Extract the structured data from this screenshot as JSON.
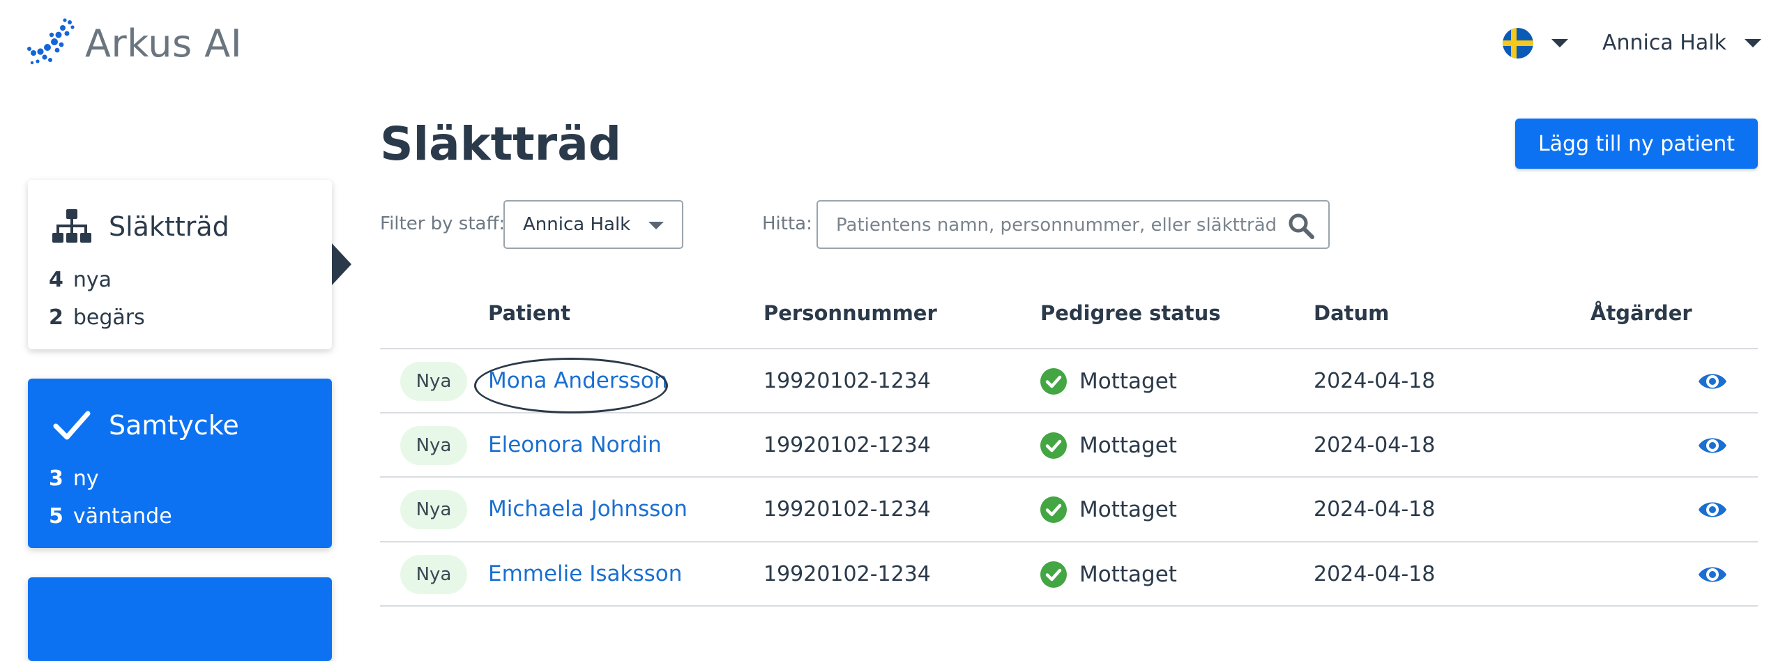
{
  "app": {
    "logo_text": "Arkus AI"
  },
  "header": {
    "language_icon": "sweden-flag-icon",
    "user_name": "Annica Halk"
  },
  "sidebar": {
    "cards": [
      {
        "title": "Släktträd",
        "icon": "family-tree-icon",
        "lines": [
          {
            "count": "4",
            "label": "nya"
          },
          {
            "count": "2",
            "label": "begärs"
          }
        ]
      },
      {
        "title": "Samtycke",
        "icon": "checkmark-icon",
        "lines": [
          {
            "count": "3",
            "label": "ny"
          },
          {
            "count": "5",
            "label": "väntande"
          }
        ]
      }
    ]
  },
  "page": {
    "title": "Släktträd",
    "add_button": "Lägg till ny patient"
  },
  "filter": {
    "label": "Filter by staff:",
    "selected": "Annica Halk"
  },
  "search": {
    "label": "Hitta:",
    "placeholder": "Patientens namn, personnummer, eller släktträd ID"
  },
  "table": {
    "columns": [
      "Patient",
      "Personnummer",
      "Pedigree status",
      "Datum",
      "Åtgärder"
    ],
    "rows": [
      {
        "badge": "Nya",
        "name": "Mona Andersson",
        "personnummer": "19920102-1234",
        "status": "Mottaget",
        "date": "2024-04-18"
      },
      {
        "badge": "Nya",
        "name": "Eleonora Nordin",
        "personnummer": "19920102-1234",
        "status": "Mottaget",
        "date": "2024-04-18"
      },
      {
        "badge": "Nya",
        "name": "Michaela Johnsson",
        "personnummer": "19920102-1234",
        "status": "Mottaget",
        "date": "2024-04-18"
      },
      {
        "badge": "Nya",
        "name": "Emmelie Isaksson",
        "personnummer": "19920102-1234",
        "status": "Mottaget",
        "date": "2024-04-18"
      }
    ]
  },
  "colors": {
    "primary": "#0d72f2",
    "text": "#2b3a4a",
    "link": "#1a6fd1",
    "success": "#43a643",
    "badge_bg": "#e8f8e8"
  }
}
